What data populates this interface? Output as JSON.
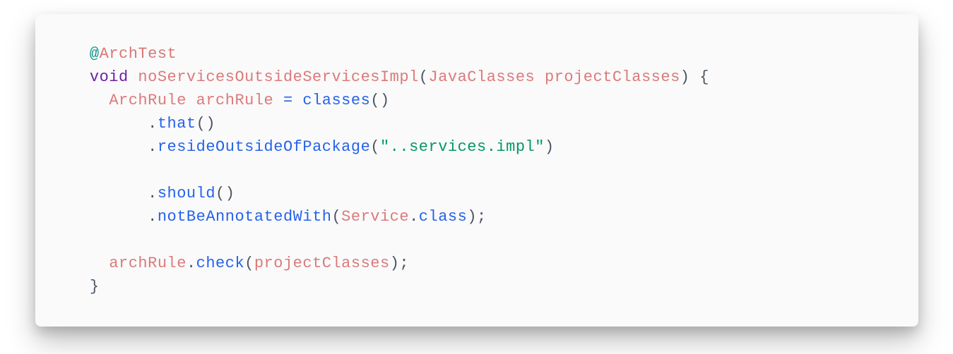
{
  "code": {
    "line1": {
      "indent": "  ",
      "at": "@",
      "annotation": "ArchTest"
    },
    "line2": {
      "indent": "  ",
      "keyword": "void",
      "space": " ",
      "method": "noServicesOutsideServicesImpl",
      "lparen": "(",
      "paramType": "JavaClasses",
      "paramSpace": " ",
      "paramName": "projectClasses",
      "rparen": ")",
      "spaceBrace": " ",
      "lbrace": "{"
    },
    "line3": {
      "indent": "    ",
      "varType": "ArchRule",
      "space1": " ",
      "varName": "archRule",
      "space2": " ",
      "eq": "=",
      "space3": " ",
      "func": "classes",
      "lparen": "(",
      "rparen": ")"
    },
    "line4": {
      "indent": "        ",
      "dot": ".",
      "method": "that",
      "lparen": "(",
      "rparen": ")"
    },
    "line5": {
      "indent": "        ",
      "dot": ".",
      "method": "resideOutsideOfPackage",
      "lparen": "(",
      "string": "\"..services.impl\"",
      "rparen": ")"
    },
    "line6": {
      "indent": "        ",
      "dot": ".",
      "method": "should",
      "lparen": "(",
      "rparen": ")"
    },
    "line7": {
      "indent": "        ",
      "dot": ".",
      "method": "notBeAnnotatedWith",
      "lparen": "(",
      "classRef": "Service",
      "dot2": ".",
      "member": "class",
      "rparen": ")",
      "semi": ";"
    },
    "line8": {
      "indent": "    ",
      "obj": "archRule",
      "dot": ".",
      "method": "check",
      "lparen": "(",
      "arg": "projectClasses",
      "rparen": ")",
      "semi": ";"
    },
    "line9": {
      "indent": "  ",
      "rbrace": "}"
    }
  }
}
